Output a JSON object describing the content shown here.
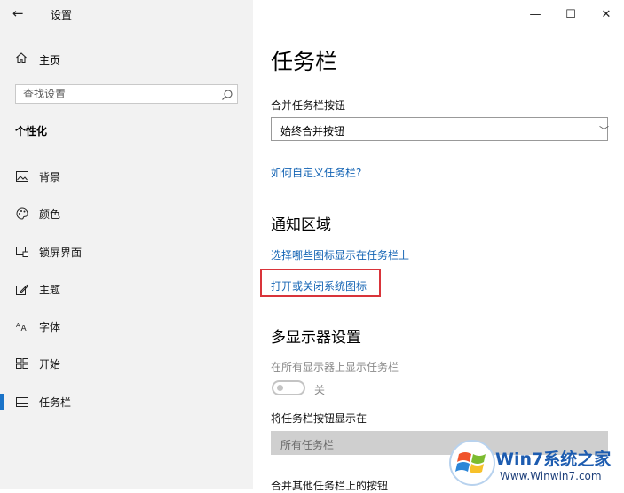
{
  "window": {
    "back_glyph": "←",
    "title": "设置",
    "minimize_glyph": "—",
    "maximize_glyph": "☐",
    "close_glyph": "✕"
  },
  "sidebar": {
    "home_label": "主页",
    "search_placeholder": "查找设置",
    "section_heading": "个性化",
    "items": [
      {
        "label": "背景",
        "icon": "picture-icon"
      },
      {
        "label": "颜色",
        "icon": "palette-icon"
      },
      {
        "label": "锁屏界面",
        "icon": "lock-screen-icon"
      },
      {
        "label": "主题",
        "icon": "theme-icon"
      },
      {
        "label": "字体",
        "icon": "font-icon"
      },
      {
        "label": "开始",
        "icon": "start-icon"
      },
      {
        "label": "任务栏",
        "icon": "taskbar-icon",
        "active": true
      }
    ]
  },
  "main": {
    "title": "任务栏",
    "combine_label": "合并任务栏按钮",
    "combine_value": "始终合并按钮",
    "customize_link": "如何自定义任务栏?",
    "notification_heading": "通知区域",
    "select_icons_link": "选择哪些图标显示在任务栏上",
    "system_icons_link": "打开或关闭系统图标",
    "multi_display_heading": "多显示器设置",
    "show_all_displays_label": "在所有显示器上显示任务栏",
    "toggle_state": "关",
    "show_buttons_label": "将任务栏按钮显示在",
    "show_buttons_value": "所有任务栏",
    "combine_other_label": "合并其他任务栏上的按钮"
  },
  "colors": {
    "sidebar_bg": "#f2f2f2",
    "accent": "#1a73c8",
    "link": "#1464b4",
    "highlight_border": "#d9343a"
  },
  "watermark": {
    "brand_text": "Win7系统之家",
    "url_text": "Www.Winwin7.com"
  }
}
